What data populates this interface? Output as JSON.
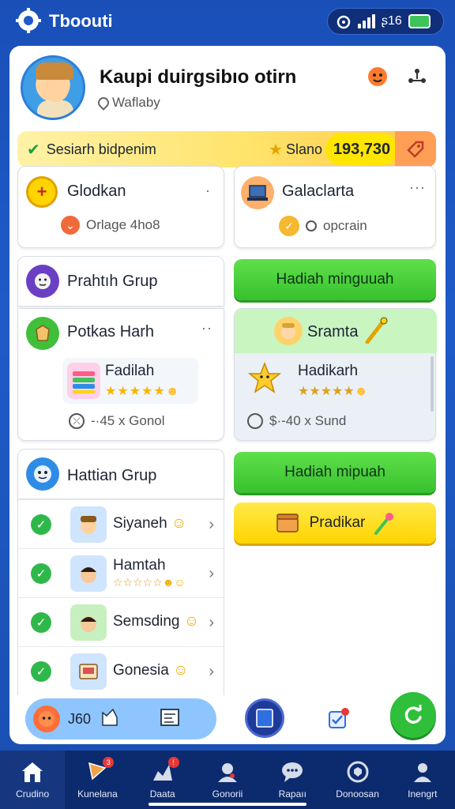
{
  "status_bar": {
    "app_name": "Tboouti",
    "status_text": "ʂ16"
  },
  "profile": {
    "name": "Kaupi duirgsibıo otirn",
    "location": "Waflaby"
  },
  "banner": {
    "text": "Sesiarh bidpenim",
    "score_label": "Slano",
    "score_value": "193,730"
  },
  "tiles": {
    "glodkan": {
      "title": "Glodkan",
      "subtitle": "Orlage 4ho8"
    },
    "galaclarta": {
      "title": "Galaclarta",
      "subtitle": "opcrain"
    },
    "prahth_grup": {
      "title": "Prahtıh Grup"
    },
    "potkas_harh": {
      "title": "Potkas Harh",
      "item_name": "Fadilah",
      "footer": "-·45 x Gonol",
      "rating": 5
    },
    "sramta": {
      "title": "Sramta",
      "item_name": "Hadikarh",
      "footer": "$·-40 x Sund",
      "rating": 5
    },
    "hattian_grup": {
      "title": "Hattian Grup"
    }
  },
  "buttons": {
    "hadiah_minguuah": "Hadiah minguuah",
    "hadiah_mipuah": "Hadiah mipuah",
    "pradikar": "Pradikar"
  },
  "group_members": [
    {
      "name": "Siyaneh"
    },
    {
      "name": "Hamtah",
      "rating": 5
    },
    {
      "name": "Semsding"
    },
    {
      "name": "Gonesia"
    }
  ],
  "bottom_bar": {
    "pill_text": "J60"
  },
  "nav": {
    "items": [
      {
        "label": "Crudino",
        "active": true
      },
      {
        "label": "Kunelana",
        "badge": "3"
      },
      {
        "label": "Daata",
        "badge": "!"
      },
      {
        "label": "Gonorii"
      },
      {
        "label": "Rapaıı"
      },
      {
        "label": "Donoosan"
      },
      {
        "label": "Inengrt"
      }
    ]
  },
  "colors": {
    "background": "#1e5bc9",
    "accent_green": "#37c12e",
    "accent_yellow": "#ffd400",
    "nav_bg": "#0c2a6e"
  }
}
